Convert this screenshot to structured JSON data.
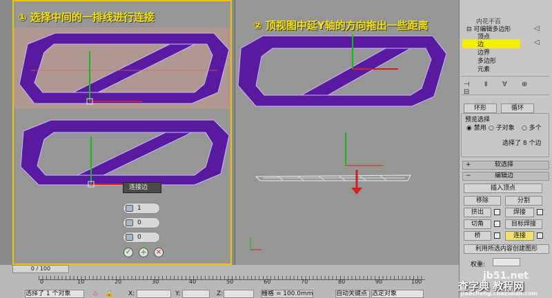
{
  "viewport_left": {
    "step_label": "① 选择中间的一排线进行连接"
  },
  "viewport_right": {
    "step_label": "② 顶视图中延Y轴的方向拖出一些距离"
  },
  "connect_caddy": {
    "title": "连接边",
    "segments": "1",
    "pinch": "0",
    "slide": "0",
    "confirm_icons": [
      "checkmark-icon",
      "plus-icon",
      "x-icon"
    ]
  },
  "command_panel": {
    "modifier_top": "内花干百",
    "tree": [
      "可编辑多边形",
      "顶点",
      "边",
      "边界",
      "多边形",
      "元素"
    ],
    "selected_item": "边",
    "row_buttons": [
      "环形",
      "循环"
    ],
    "preview_selection_label": "预览选择",
    "preview_options": [
      "禁用",
      "子对象",
      "多个"
    ],
    "selection_status": "选择了 8 个边",
    "soft_selection": "软选择",
    "edit_edges": "编辑边",
    "insert_vertex": "插入顶点",
    "buttons": [
      [
        "移除",
        "分割"
      ],
      [
        "挤出",
        "焊接"
      ],
      [
        "切角",
        "目标焊接"
      ],
      [
        "桥",
        "连接"
      ]
    ],
    "create_shape": "利用所选内容创建图形",
    "weight_label": "权重:"
  },
  "timeline": {
    "frame_display": "0 / 100",
    "ticks": [
      "0",
      "10",
      "20",
      "30",
      "40",
      "50",
      "60",
      "70",
      "80",
      "90",
      "100"
    ]
  },
  "status_bar": {
    "selection": "选择了 1 个对象",
    "x_label": "X:",
    "y_label": "Y:",
    "z_label": "Z:",
    "grid": "栅格 = 100.0mm",
    "auto_key": "自动关键点",
    "set_key_dropdown": "选定对象"
  },
  "watermarks": {
    "main": "查字典 教程网",
    "url": "jiaocheng.chazidian.com",
    "logo": "jb51.net"
  },
  "colors": {
    "mesh_purple": "#5a1aa0",
    "highlight_yellow": "#f5ee00",
    "active_border": "#f2c100",
    "label_yellow": "#f5e300"
  }
}
